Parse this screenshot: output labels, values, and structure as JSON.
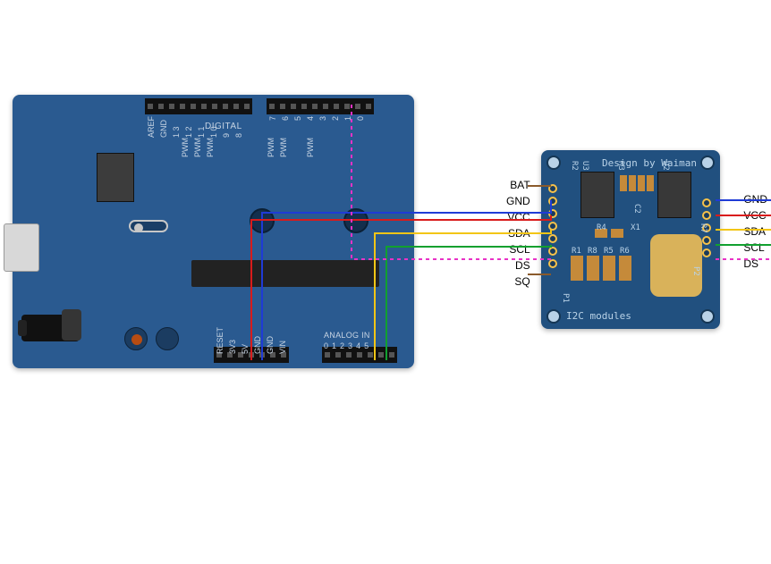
{
  "arduino": {
    "top_header_1_labels": [
      "AREF",
      "GND",
      "1 3",
      "1 2",
      "1 1",
      "1 0",
      "9",
      "8"
    ],
    "top_header_2_labels": [
      "7",
      "6",
      "5",
      "4",
      "3",
      "2",
      "1",
      "0"
    ],
    "digital_label": "DIGITAL",
    "pwm_labels": [
      "PWM",
      "PWM",
      "PWM",
      "",
      "",
      "PWM",
      "PWM",
      "",
      "PWM"
    ],
    "power_labels": [
      "RESET",
      "3V3",
      "5V",
      "GND",
      "GND",
      "VIN"
    ],
    "analog_title": "ANALOG IN",
    "analog_labels": [
      "0",
      "1",
      "2",
      "3",
      "4",
      "5"
    ]
  },
  "module": {
    "title": "Design by Waiman",
    "footer": "I2C modules",
    "left_pins": [
      "BAT",
      "GND",
      "VCC",
      "SDA",
      "SCL",
      "DS",
      "SQ"
    ],
    "right_pins": [
      "GND",
      "VCC",
      "SDA",
      "SCL",
      "DS"
    ],
    "refs": {
      "P1": "P1",
      "P2": "P2",
      "U2": "U2",
      "U3": "U3",
      "R2": "R2",
      "R3": "R3",
      "C2": "C2",
      "R4": "R4",
      "X1": "X1",
      "R1": "R1",
      "R8": "R8",
      "R5": "R5",
      "R6": "R6",
      "R7": "R7"
    }
  },
  "wires": {
    "gnd": {
      "color": "#1f3bd6"
    },
    "vcc": {
      "color": "#d91b1b"
    },
    "sda": {
      "color": "#f2c516"
    },
    "scl": {
      "color": "#11a02f"
    },
    "ds": {
      "color": "#e832c6"
    },
    "sq": {
      "color": "#8a5a2b"
    }
  },
  "connections": [
    {
      "signal": "GND",
      "from": "Arduino GND (power)",
      "to": "Module GND (left)",
      "to2": "Module GND (right)",
      "color": "blue"
    },
    {
      "signal": "VCC",
      "from": "Arduino 5V",
      "to": "Module VCC (left)",
      "to2": "Module VCC (right)",
      "color": "red"
    },
    {
      "signal": "SDA",
      "from": "Arduino A4",
      "to": "Module SDA (left)",
      "to2": "Module SDA (right)",
      "color": "yellow"
    },
    {
      "signal": "SCL",
      "from": "Arduino A5",
      "to": "Module SCL (left)",
      "to2": "Module SCL (right)",
      "color": "green"
    },
    {
      "signal": "DS",
      "from": "Arduino D2",
      "to": "Module DS (left)",
      "to2": "Module DS (right)",
      "color": "magenta-dashed"
    },
    {
      "signal": "SQ",
      "from": "(unconnected stub)",
      "to": "Module SQ (left)",
      "color": "brown"
    },
    {
      "signal": "BAT",
      "from": "(unconnected stub)",
      "to": "Module BAT (left)",
      "color": "brown"
    }
  ]
}
